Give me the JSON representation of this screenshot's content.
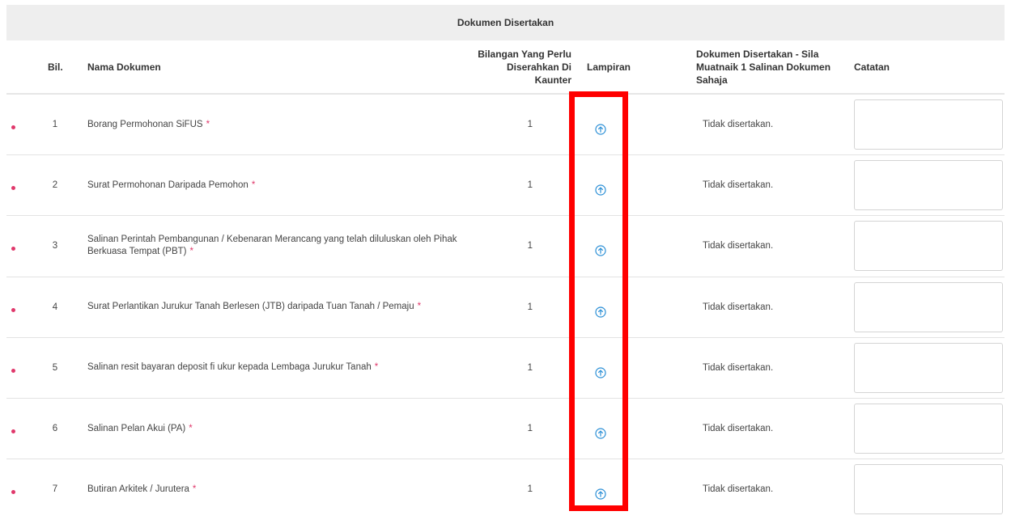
{
  "section": {
    "title": "Dokumen Disertakan"
  },
  "columns": {
    "bil": "Bil.",
    "nama": "Nama Dokumen",
    "bilangan": "Bilangan Yang Perlu Diserahkan Di Kaunter",
    "lampiran": "Lampiran",
    "disertakan": "Dokumen Disertakan - Sila Muatnaik 1 Salinan Dokumen Sahaja",
    "catatan": "Catatan"
  },
  "rows": [
    {
      "no": "1",
      "name": "Borang Permohonan SiFUS",
      "required_mark": "*",
      "qty": "1",
      "status": "Tidak disertakan."
    },
    {
      "no": "2",
      "name": "Surat Permohonan Daripada Pemohon",
      "required_mark": "*",
      "qty": "1",
      "status": "Tidak disertakan."
    },
    {
      "no": "3",
      "name": "Salinan Perintah Pembangunan / Kebenaran Merancang yang telah diluluskan oleh Pihak Berkuasa Tempat (PBT)",
      "required_mark": "*",
      "qty": "1",
      "status": "Tidak disertakan."
    },
    {
      "no": "4",
      "name": "Surat Perlantikan Jurukur Tanah Berlesen (JTB) daripada Tuan Tanah / Pemaju",
      "required_mark": "*",
      "qty": "1",
      "status": "Tidak disertakan."
    },
    {
      "no": "5",
      "name": "Salinan resit bayaran deposit fi ukur kepada Lembaga Jurukur Tanah",
      "required_mark": "*",
      "qty": "1",
      "status": "Tidak disertakan."
    },
    {
      "no": "6",
      "name": "Salinan Pelan Akui (PA)",
      "required_mark": "*",
      "qty": "1",
      "status": "Tidak disertakan."
    },
    {
      "no": "7",
      "name": "Butiran Arkitek / Jurutera",
      "required_mark": "*",
      "qty": "1",
      "status": "Tidak disertakan."
    }
  ],
  "icons": {
    "upload": "upload-circle-icon"
  },
  "colors": {
    "accent": "#2b8fd6",
    "required": "#e0386b",
    "highlight": "#ff0000"
  }
}
